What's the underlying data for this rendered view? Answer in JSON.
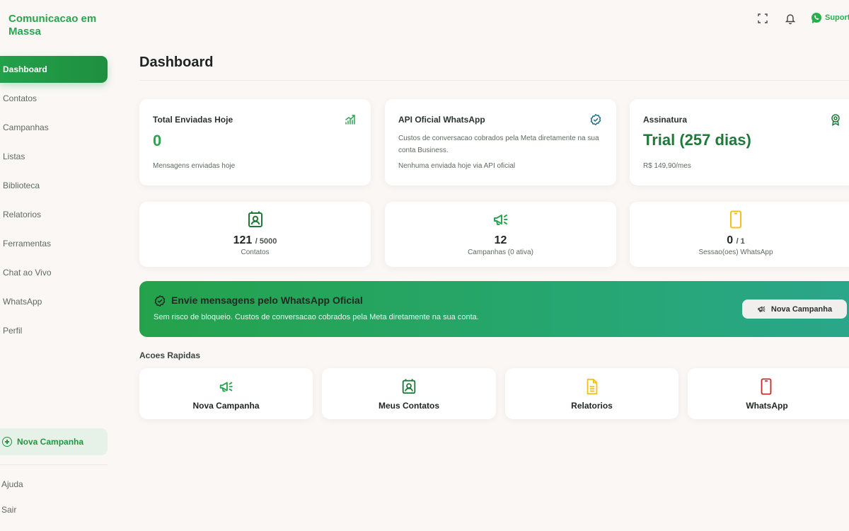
{
  "brand": "Comunicacao em Massa",
  "sidebar": {
    "items": [
      {
        "label": "Dashboard",
        "active": true
      },
      {
        "label": "Contatos"
      },
      {
        "label": "Campanhas"
      },
      {
        "label": "Listas"
      },
      {
        "label": "Biblioteca"
      },
      {
        "label": "Relatorios"
      },
      {
        "label": "Ferramentas"
      },
      {
        "label": "Chat ao Vivo"
      },
      {
        "label": "WhatsApp"
      },
      {
        "label": "Perfil"
      }
    ],
    "new_campaign": "Nova Campanha",
    "help": "Ajuda",
    "logout": "Sair"
  },
  "topbar": {
    "icons": [
      "fullscreen-icon",
      "bell-icon",
      "whatsapp-icon"
    ],
    "support": "Suporte"
  },
  "page": {
    "title": "Dashboard"
  },
  "cards": {
    "sent_today": {
      "title": "Total Enviadas Hoje",
      "value": "0",
      "subtitle": "Mensagens enviadas hoje",
      "icon": "chart-up-icon"
    },
    "api": {
      "title": "API Oficial WhatsApp",
      "description": "Custos de conversacao cobrados pela Meta diretamente na sua conta Business.",
      "note": "Nenhuma enviada hoje via API oficial",
      "icon": "verified-icon"
    },
    "subscription": {
      "title": "Assinatura",
      "value": "Trial (257 dias)",
      "price": "R$ 149,90/mes",
      "icon": "award-icon"
    }
  },
  "stats": {
    "contacts": {
      "value": "121",
      "limit": "/ 5000",
      "label": "Contatos",
      "icon": "contact-card-icon"
    },
    "campaigns": {
      "value": "12",
      "label": "Campanhas (0 ativa)",
      "icon": "megaphone-icon"
    },
    "sessions": {
      "value": "0",
      "limit": "/ 1",
      "label": "Sessao(oes) WhatsApp",
      "icon": "phone-icon"
    }
  },
  "banner": {
    "title": "Envie mensagens pelo WhatsApp Oficial",
    "subtitle": "Sem risco de bloqueio. Custos de conversacao cobrados pela Meta diretamente na sua conta.",
    "button": "Nova Campanha"
  },
  "quick_actions": {
    "title": "Acoes Rapidas",
    "items": [
      {
        "label": "Nova Campanha",
        "icon": "megaphone-icon"
      },
      {
        "label": "Meus Contatos",
        "icon": "contact-card-icon"
      },
      {
        "label": "Relatorios",
        "icon": "document-icon"
      },
      {
        "label": "WhatsApp",
        "icon": "phone-icon"
      }
    ]
  },
  "colors": {
    "accent": "#22a04a",
    "dark_green": "#1f7a3a",
    "yellow": "#f2c21b",
    "red": "#c0312b",
    "background": "#faf7f5"
  }
}
